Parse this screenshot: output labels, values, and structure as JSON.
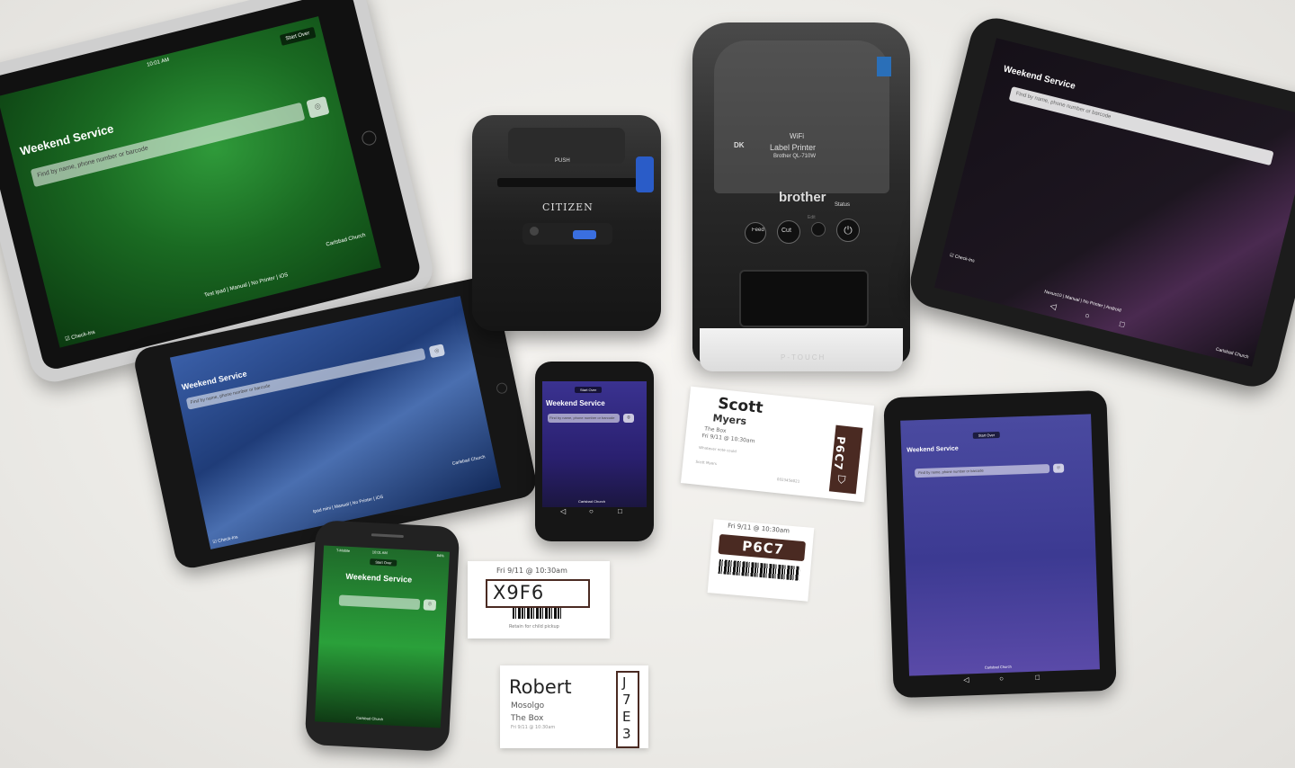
{
  "app": {
    "title": "Weekend Service",
    "start_over": "Start Over",
    "org": "Carlsbad Church",
    "brand": "Check-Ins"
  },
  "ipad_large": {
    "time": "10:01 AM",
    "footer": "Test Ipad | Manual | No Printer | iOS",
    "search_placeholder": "Find by name, phone number or barcode"
  },
  "ipad_mini": {
    "footer": "Ipad mini | Manual | No Printer | iOS",
    "search_placeholder": "Find by name, phone number or barcode"
  },
  "android_tablet": {
    "footer": "Nexus10 | Manual | No Printer | Android",
    "search_placeholder": "Find by name, phone number or barcode"
  },
  "nexus7": {
    "search_placeholder": "Find by name, phone number or barcode"
  },
  "nexus4": {
    "search_placeholder": "Find by name, phone number or barcode"
  },
  "iphone": {
    "carrier": "T-Mobile",
    "time": "10:01 AM",
    "battery": "84%"
  },
  "printers": {
    "citizen": {
      "brand": "CITIZEN",
      "push": "PUSH"
    },
    "brother": {
      "brand": "brother",
      "wifi": "WiFi",
      "model_title": "Label Printer",
      "model": "Brother QL-710W",
      "cut": "Cut",
      "status": "Status",
      "feed": "Feed",
      "edit": "Edit",
      "dk": "DK",
      "base_text": "P-TOUCH"
    }
  },
  "labels": {
    "scott": {
      "first": "Scott",
      "last": "Myers",
      "room": "The Box",
      "datetime": "Fri 9/11 @ 10:30am",
      "note": "Whatever note could",
      "guardian": "Scott Myers",
      "id": "0023456021",
      "code": "P6C7"
    },
    "p6c7_tag": {
      "datetime": "Fri 9/11 @ 10:30am",
      "code": "P6C7"
    },
    "x9f6": {
      "datetime": "Fri 9/11 @ 10:30am",
      "code": "X9F6",
      "note": "Retain for child pickup"
    },
    "robert": {
      "first": "Robert",
      "last": "Mosolgo",
      "room": "The Box",
      "datetime": "Fri 9/11 @ 10:30am",
      "code": "J7E3"
    }
  },
  "colors": {
    "green_screen": "#1f7a2a",
    "blue_screen": "#2a4f8a",
    "purple_screen": "#4a3e8e",
    "dark_screen": "#151018",
    "label_dark": "#4a2a22"
  }
}
